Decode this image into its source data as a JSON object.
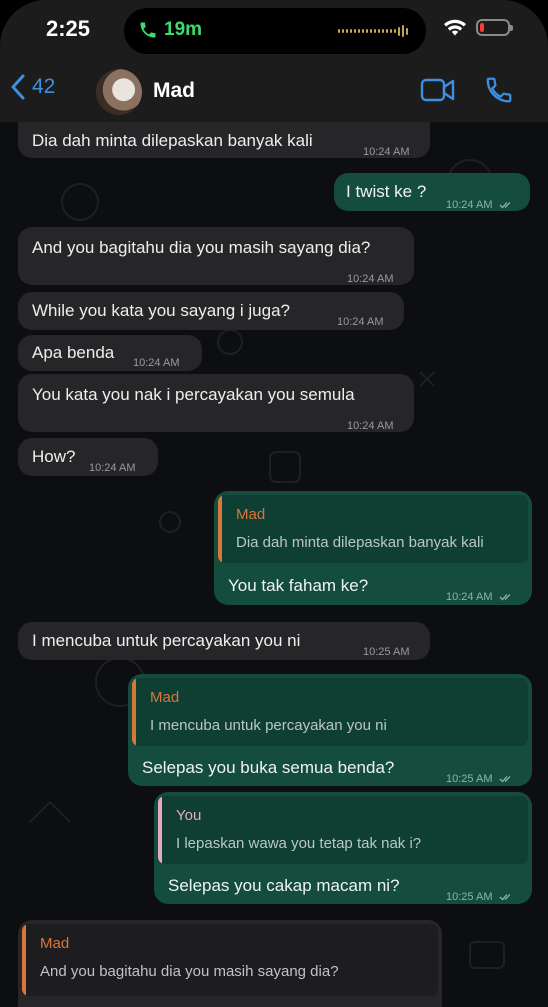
{
  "status_bar": {
    "time": "2:25",
    "call_duration": "19m",
    "battery_color": "#ff3b30",
    "call_color": "#3ddc6f"
  },
  "header": {
    "back_count": "42",
    "contact_name": "Mad",
    "accent_color": "#3d8fe0",
    "icons": [
      "chevron-left-icon",
      "video-call-icon",
      "phone-icon"
    ]
  },
  "messages": [
    {
      "direction": "in",
      "text": "Dia dah minta dilepaskan banyak kali",
      "time": "10:24 AM"
    },
    {
      "direction": "out",
      "text": "I twist ke ?",
      "time": "10:24 AM",
      "read": true
    },
    {
      "direction": "in",
      "text": "And you bagitahu dia you masih sayang dia?",
      "time": "10:24 AM"
    },
    {
      "direction": "in",
      "text": "While you kata you sayang i juga?",
      "time": "10:24 AM"
    },
    {
      "direction": "in",
      "text": "Apa benda",
      "time": "10:24 AM"
    },
    {
      "direction": "in",
      "text": "You kata you nak i percayakan you semula",
      "time": "10:24 AM"
    },
    {
      "direction": "in",
      "text": "How?",
      "time": "10:24 AM"
    },
    {
      "direction": "out",
      "quote_name": "Mad",
      "quote_text": "Dia dah minta dilepaskan banyak kali",
      "text": "You tak faham ke?",
      "time": "10:24 AM",
      "read": true
    },
    {
      "direction": "in",
      "text": "I mencuba untuk percayakan you ni",
      "time": "10:25 AM"
    },
    {
      "direction": "out",
      "quote_name": "Mad",
      "quote_text": "I mencuba untuk percayakan you ni",
      "text": "Selepas you buka semua benda?",
      "time": "10:25 AM",
      "read": true
    },
    {
      "direction": "out",
      "quote_name": "You",
      "quote_text": "I lepaskan wawa you tetap tak nak i?",
      "text": "Selepas you cakap macam ni?",
      "time": "10:25 AM",
      "read": true
    },
    {
      "direction": "in",
      "quote_name": "Mad",
      "quote_text": "And you bagitahu dia you masih sayang dia?",
      "text": "",
      "time": ""
    }
  ],
  "colors": {
    "incoming_bubble": "#262628",
    "outgoing_bubble": "#144d3e",
    "quote_mad": "#d9763a",
    "quote_you": "#e7a9c0"
  }
}
